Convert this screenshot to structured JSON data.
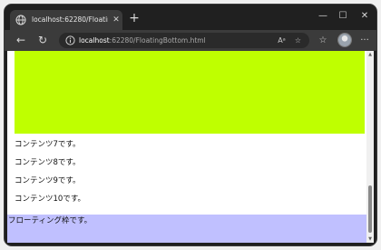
{
  "tab": {
    "title": "localhost:62280/FloatingBottom.html",
    "close_label": "✕",
    "favicon": "globe-icon"
  },
  "new_tab_label": "+",
  "window_controls": {
    "minimize": "—",
    "maximize": "☐",
    "close": "✕"
  },
  "toolbar": {
    "back_label": "←",
    "refresh_label": "↻",
    "url_host": "localhost",
    "url_rest": ":62280/FloatingBottom.html",
    "read_aloud_label": "Aᵃ",
    "favorite_label": "☆",
    "favorites_label": "☆",
    "more_label": "···"
  },
  "page": {
    "green_color": "#bfff00",
    "lines": [
      "コンテンツ7です。",
      "コンテンツ8です。",
      "コンテンツ9です。",
      "コンテンツ10です。"
    ],
    "floating_text": "フローティング枠です。",
    "floating_color": "#c0c0ff"
  },
  "scrollbar": {
    "up_arrow": "▲",
    "down_arrow": "▼"
  }
}
